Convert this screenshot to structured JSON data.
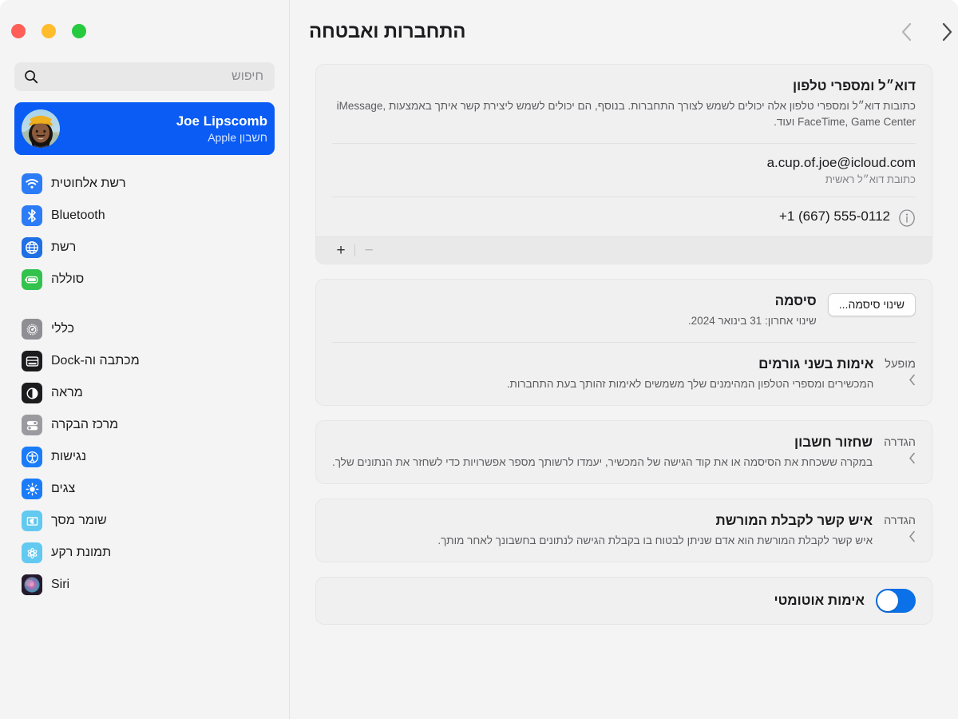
{
  "window": {
    "traffic_lights": [
      {
        "name": "close-button",
        "color": "#27c93f",
        "label": "green"
      },
      {
        "name": "minimize-button",
        "color": "#ffbd2e",
        "label": "yellow"
      },
      {
        "name": "maximize-button",
        "color": "#ff5f57",
        "label": "red"
      }
    ]
  },
  "sidebar": {
    "search": {
      "placeholder": "חיפוש",
      "icon": "search-icon"
    },
    "account": {
      "name": "Joe Lipscomb",
      "subtitle": "חשבון Apple",
      "avatar_alt": "avatar",
      "accent": "#0a5cf5"
    },
    "groups": [
      {
        "items": [
          {
            "label": "רשת אלחוטית",
            "icon": "wifi-icon",
            "color": "#2b7cf6"
          },
          {
            "label": "Bluetooth",
            "icon": "bluetooth-icon",
            "color": "#2b7cf6"
          },
          {
            "label": "רשת",
            "icon": "globe-icon",
            "color": "#1f6fe5"
          },
          {
            "label": "סוללה",
            "icon": "battery-icon",
            "color": "#33c24d"
          }
        ]
      },
      {
        "items": [
          {
            "label": "כללי",
            "icon": "gear-icon",
            "color": "#8e8e93"
          },
          {
            "label": "מכתבה וה-Dock",
            "icon": "desktop-dock-icon",
            "color": "#1c1c1e"
          },
          {
            "label": "מראה",
            "icon": "appearance-icon",
            "color": "#1c1c1e"
          },
          {
            "label": "מרכז הבקרה",
            "icon": "control-center-icon",
            "color": "#9b9b9f"
          },
          {
            "label": "נגישות",
            "icon": "accessibility-icon",
            "color": "#1a7cf8"
          },
          {
            "label": "צגים",
            "icon": "displays-icon",
            "color": "#1a7cf8"
          },
          {
            "label": "שומר מסך",
            "icon": "screensaver-icon",
            "color": "#62c9f0"
          },
          {
            "label": "תמונת רקע",
            "icon": "wallpaper-icon",
            "color": "#62c9f0"
          },
          {
            "label": "Siri",
            "icon": "siri-icon",
            "color": "#3a2340"
          }
        ]
      }
    ]
  },
  "main": {
    "title": "התחברות ואבטחה",
    "nav": {
      "back_label": "chevron-back-icon",
      "forward_label": "chevron-forward-icon",
      "back_enabled": false,
      "forward_enabled": true
    },
    "sections": [
      {
        "id": "contact",
        "title": "דוא״ל ומספרי טלפון",
        "desc": "כתובות דוא״ל ומספרי טלפון אלה יכולים לשמש לצורך התחברות. בנוסף, הם יכולים לשמש ליצירת קשר איתך באמצעות iMessage, FaceTime, Game Center ועוד.",
        "rows": [
          {
            "value": "a.cup.of.joe@icloud.com",
            "sub": "כתובת דוא״ל ראשית",
            "info": false
          },
          {
            "value": "+1 (667) 555-0112",
            "sub": "",
            "info": true
          }
        ],
        "toolbar": {
          "add": "+",
          "remove": "−",
          "add_enabled": true,
          "remove_enabled": false
        }
      },
      {
        "id": "password",
        "title": "סיסמה",
        "desc": "שינוי אחרון: 31 בינואר 2024.",
        "button": "שינוי סיסמה...",
        "sub_row": {
          "title": "אימות בשני גורמים",
          "desc": "המכשירים ומספרי הטלפון המהימנים שלך משמשים לאימות זהותך בעת התחברות.",
          "status": "מופעל"
        }
      },
      {
        "id": "account-recovery",
        "title": "שחזור חשבון",
        "desc": "במקרה ששכחת את הסיסמה או את קוד הגישה של המכשיר, יעמדו לרשותך מספר אפשרויות כדי לשחזר את הנתונים שלך.",
        "status": "הגדרה"
      },
      {
        "id": "legacy-contact",
        "title": "איש קשר לקבלת המורשת",
        "desc": "איש קשר לקבלת המורשת הוא אדם שניתן לבטוח בו בקבלת הגישה לנתונים בחשבונך לאחר מותך.",
        "status": "הגדרה"
      },
      {
        "id": "automatic-verification",
        "title": "אימות אוטומטי",
        "toggle_on": true
      }
    ]
  }
}
